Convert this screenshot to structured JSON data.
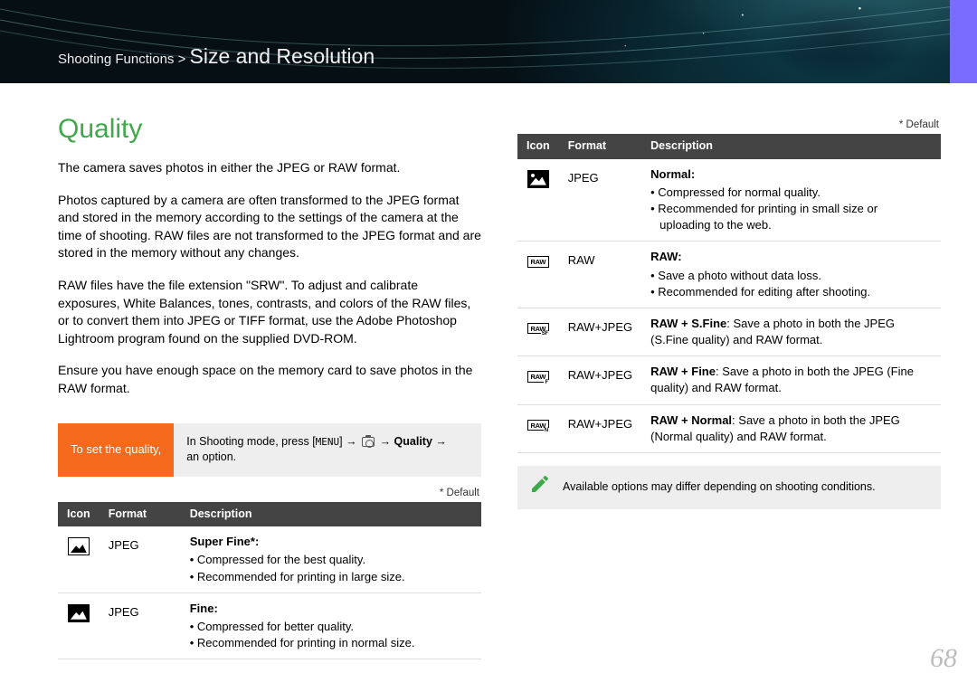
{
  "breadcrumb": {
    "parent": "Shooting Functions",
    "sep": ">",
    "current": "Size and Resolution"
  },
  "section_title": "Quality",
  "paragraphs": {
    "p1": "The camera saves photos in either the JPEG or RAW format.",
    "p2": "Photos captured by a camera are often transformed to the JPEG format and stored in the memory according to the settings of the camera at the time of shooting. RAW files are not transformed to the JPEG format and are stored in the memory without any changes.",
    "p3": "RAW files have the file extension \"SRW\". To adjust and calibrate exposures, White Balances, tones, contrasts, and colors of the RAW files, or to convert them into JPEG or TIFF format, use the Adobe Photoshop Lightroom program found on the supplied DVD-ROM.",
    "p4": "Ensure you have enough space on the memory card to save photos in the RAW format."
  },
  "set_box": {
    "label": "To set the quality,",
    "instr_prefix": "In Shooting mode, press [",
    "instr_menu": "MENU",
    "instr_mid1": "] → ",
    "instr_mid2": " → ",
    "instr_bold": "Quality",
    "instr_mid3": " → ",
    "instr_suffix": "an option."
  },
  "default_label": "* Default",
  "table_headers": {
    "icon": "Icon",
    "format": "Format",
    "desc": "Description"
  },
  "rows_left": [
    {
      "format": "JPEG",
      "title": "Super Fine*",
      "bullets": [
        "Compressed for the best quality.",
        "Recommended for printing in large size."
      ]
    },
    {
      "format": "JPEG",
      "title": "Fine",
      "bullets": [
        "Compressed for better quality.",
        "Recommended for printing in normal size."
      ]
    }
  ],
  "rows_right": [
    {
      "format": "JPEG",
      "title": "Normal",
      "bullets": [
        "Compressed for normal quality.",
        "Recommended for printing in small size or uploading to the web."
      ]
    },
    {
      "format": "RAW",
      "title": "RAW",
      "bullets": [
        "Save a photo without data loss.",
        "Recommended for editing after shooting."
      ]
    },
    {
      "format": "RAW+JPEG",
      "inline_title": "RAW + S.Fine",
      "inline_body": ": Save a photo in both the JPEG (S.Fine quality) and RAW format."
    },
    {
      "format": "RAW+JPEG",
      "inline_title": "RAW + Fine",
      "inline_body": ": Save a photo in both the JPEG (Fine quality) and RAW format."
    },
    {
      "format": "RAW+JPEG",
      "inline_title": "RAW + Normal",
      "inline_body": ": Save a photo in both the JPEG (Normal quality) and RAW format."
    }
  ],
  "note_text": "Available options may differ depending on shooting conditions.",
  "page_number": "68"
}
